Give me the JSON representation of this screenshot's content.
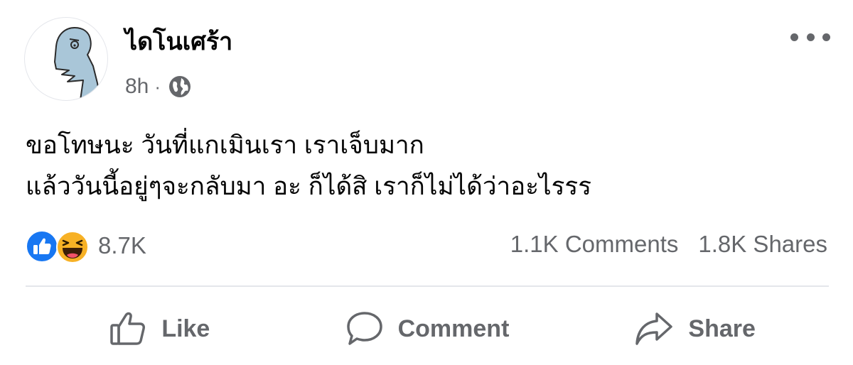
{
  "post": {
    "author": "ไดโนเศร้า",
    "time": "8h",
    "separator": "·",
    "privacy_icon": "globe-icon",
    "text_lines": [
      "ขอโทษนะ วันที่แกเมินเรา เราเจ็บมาก",
      "แล้ววันนี้อยู่ๆจะกลับมา อะ ก็ได้สิ เราก็ไม่ได้ว่าอะไรรร"
    ]
  },
  "reactions": {
    "icons": [
      "like-reaction-icon",
      "haha-reaction-icon"
    ],
    "count": "8.7K"
  },
  "stats": {
    "comments": "1.1K Comments",
    "shares": "1.8K Shares"
  },
  "actions": {
    "like_label": "Like",
    "comment_label": "Comment",
    "share_label": "Share"
  },
  "colors": {
    "secondary_text": "#65676b",
    "like_blue": "#1877f2",
    "haha_yellow": "#f7b125",
    "avatar_dino": "#a9c6d8"
  }
}
